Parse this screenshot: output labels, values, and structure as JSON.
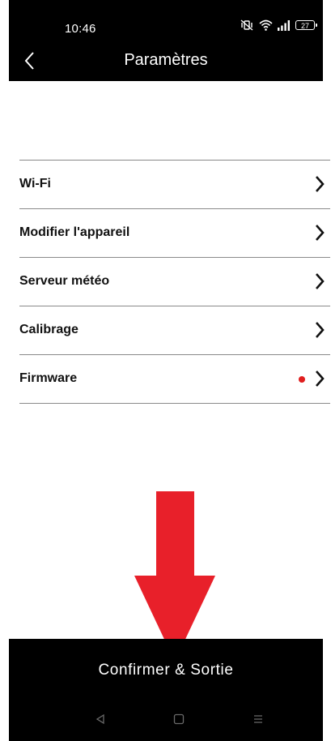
{
  "status_bar": {
    "time": "10:46",
    "battery": "27",
    "icons": [
      "mute-vibrate-icon",
      "wifi-icon",
      "signal-icon",
      "battery-icon"
    ]
  },
  "header": {
    "title": "Paramètres",
    "back_icon": "chevron-left-icon"
  },
  "settings": {
    "items": [
      {
        "label": "Wi-Fi",
        "has_update_dot": false
      },
      {
        "label": "Modifier l'appareil",
        "has_update_dot": false
      },
      {
        "label": "Serveur météo",
        "has_update_dot": false
      },
      {
        "label": "Calibrage",
        "has_update_dot": false
      },
      {
        "label": "Firmware",
        "has_update_dot": true
      }
    ]
  },
  "footer": {
    "confirm_label": "Confirmer & Sortie"
  },
  "annotation": {
    "arrow_direction": "down",
    "arrow_color": "#e8202a"
  },
  "colors": {
    "bar_background": "#000000",
    "update_dot": "#e01e1e",
    "divider": "#8a8a8a"
  }
}
